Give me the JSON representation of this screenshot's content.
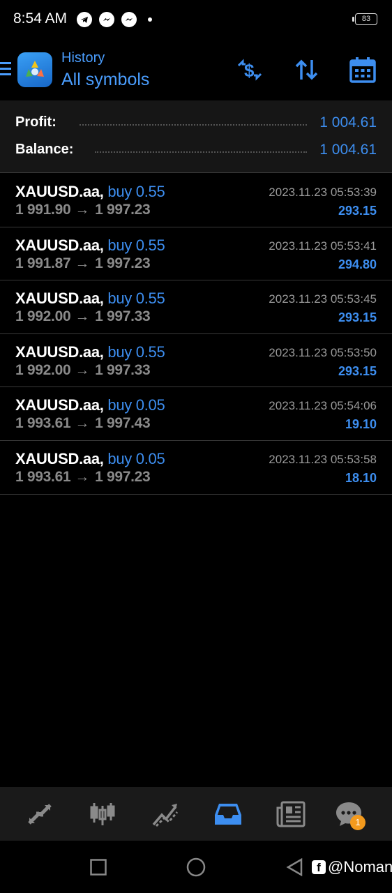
{
  "status_bar": {
    "time": "8:54 AM",
    "battery": "83",
    "icons": [
      "telegram-icon",
      "messenger-icon",
      "messenger-icon"
    ]
  },
  "header": {
    "subtitle": "History",
    "title": "All symbols",
    "actions": [
      "currency-switch-icon",
      "sort-icon",
      "calendar-icon"
    ]
  },
  "summary": {
    "profit_label": "Profit:",
    "profit_value": "1 004.61",
    "balance_label": "Balance:",
    "balance_value": "1 004.61"
  },
  "trades": [
    {
      "symbol": "XAUUSD.aa,",
      "type": "buy 0.55",
      "open": "1 991.90",
      "close": "1 997.23",
      "time": "2023.11.23 05:53:39",
      "profit": "293.15"
    },
    {
      "symbol": "XAUUSD.aa,",
      "type": "buy 0.55",
      "open": "1 991.87",
      "close": "1 997.23",
      "time": "2023.11.23 05:53:41",
      "profit": "294.80"
    },
    {
      "symbol": "XAUUSD.aa,",
      "type": "buy 0.55",
      "open": "1 992.00",
      "close": "1 997.33",
      "time": "2023.11.23 05:53:45",
      "profit": "293.15"
    },
    {
      "symbol": "XAUUSD.aa,",
      "type": "buy 0.55",
      "open": "1 992.00",
      "close": "1 997.33",
      "time": "2023.11.23 05:53:50",
      "profit": "293.15"
    },
    {
      "symbol": "XAUUSD.aa,",
      "type": "buy 0.05",
      "open": "1 993.61",
      "close": "1 997.43",
      "time": "2023.11.23 05:54:06",
      "profit": "19.10"
    },
    {
      "symbol": "XAUUSD.aa,",
      "type": "buy 0.05",
      "open": "1 993.61",
      "close": "1 997.23",
      "time": "2023.11.23 05:53:58",
      "profit": "18.10"
    }
  ],
  "arrow_glyph": "→",
  "bottom_nav": {
    "items": [
      "quotes-icon",
      "chart-icon",
      "trade-icon",
      "history-icon",
      "news-icon",
      "chat-icon"
    ],
    "active": "history-icon",
    "chat_badge": "1"
  },
  "watermark": {
    "fb_glyph": "f",
    "text": "@Noman"
  },
  "colors": {
    "accent": "#3d8ef0",
    "badge": "#f39a1d"
  }
}
